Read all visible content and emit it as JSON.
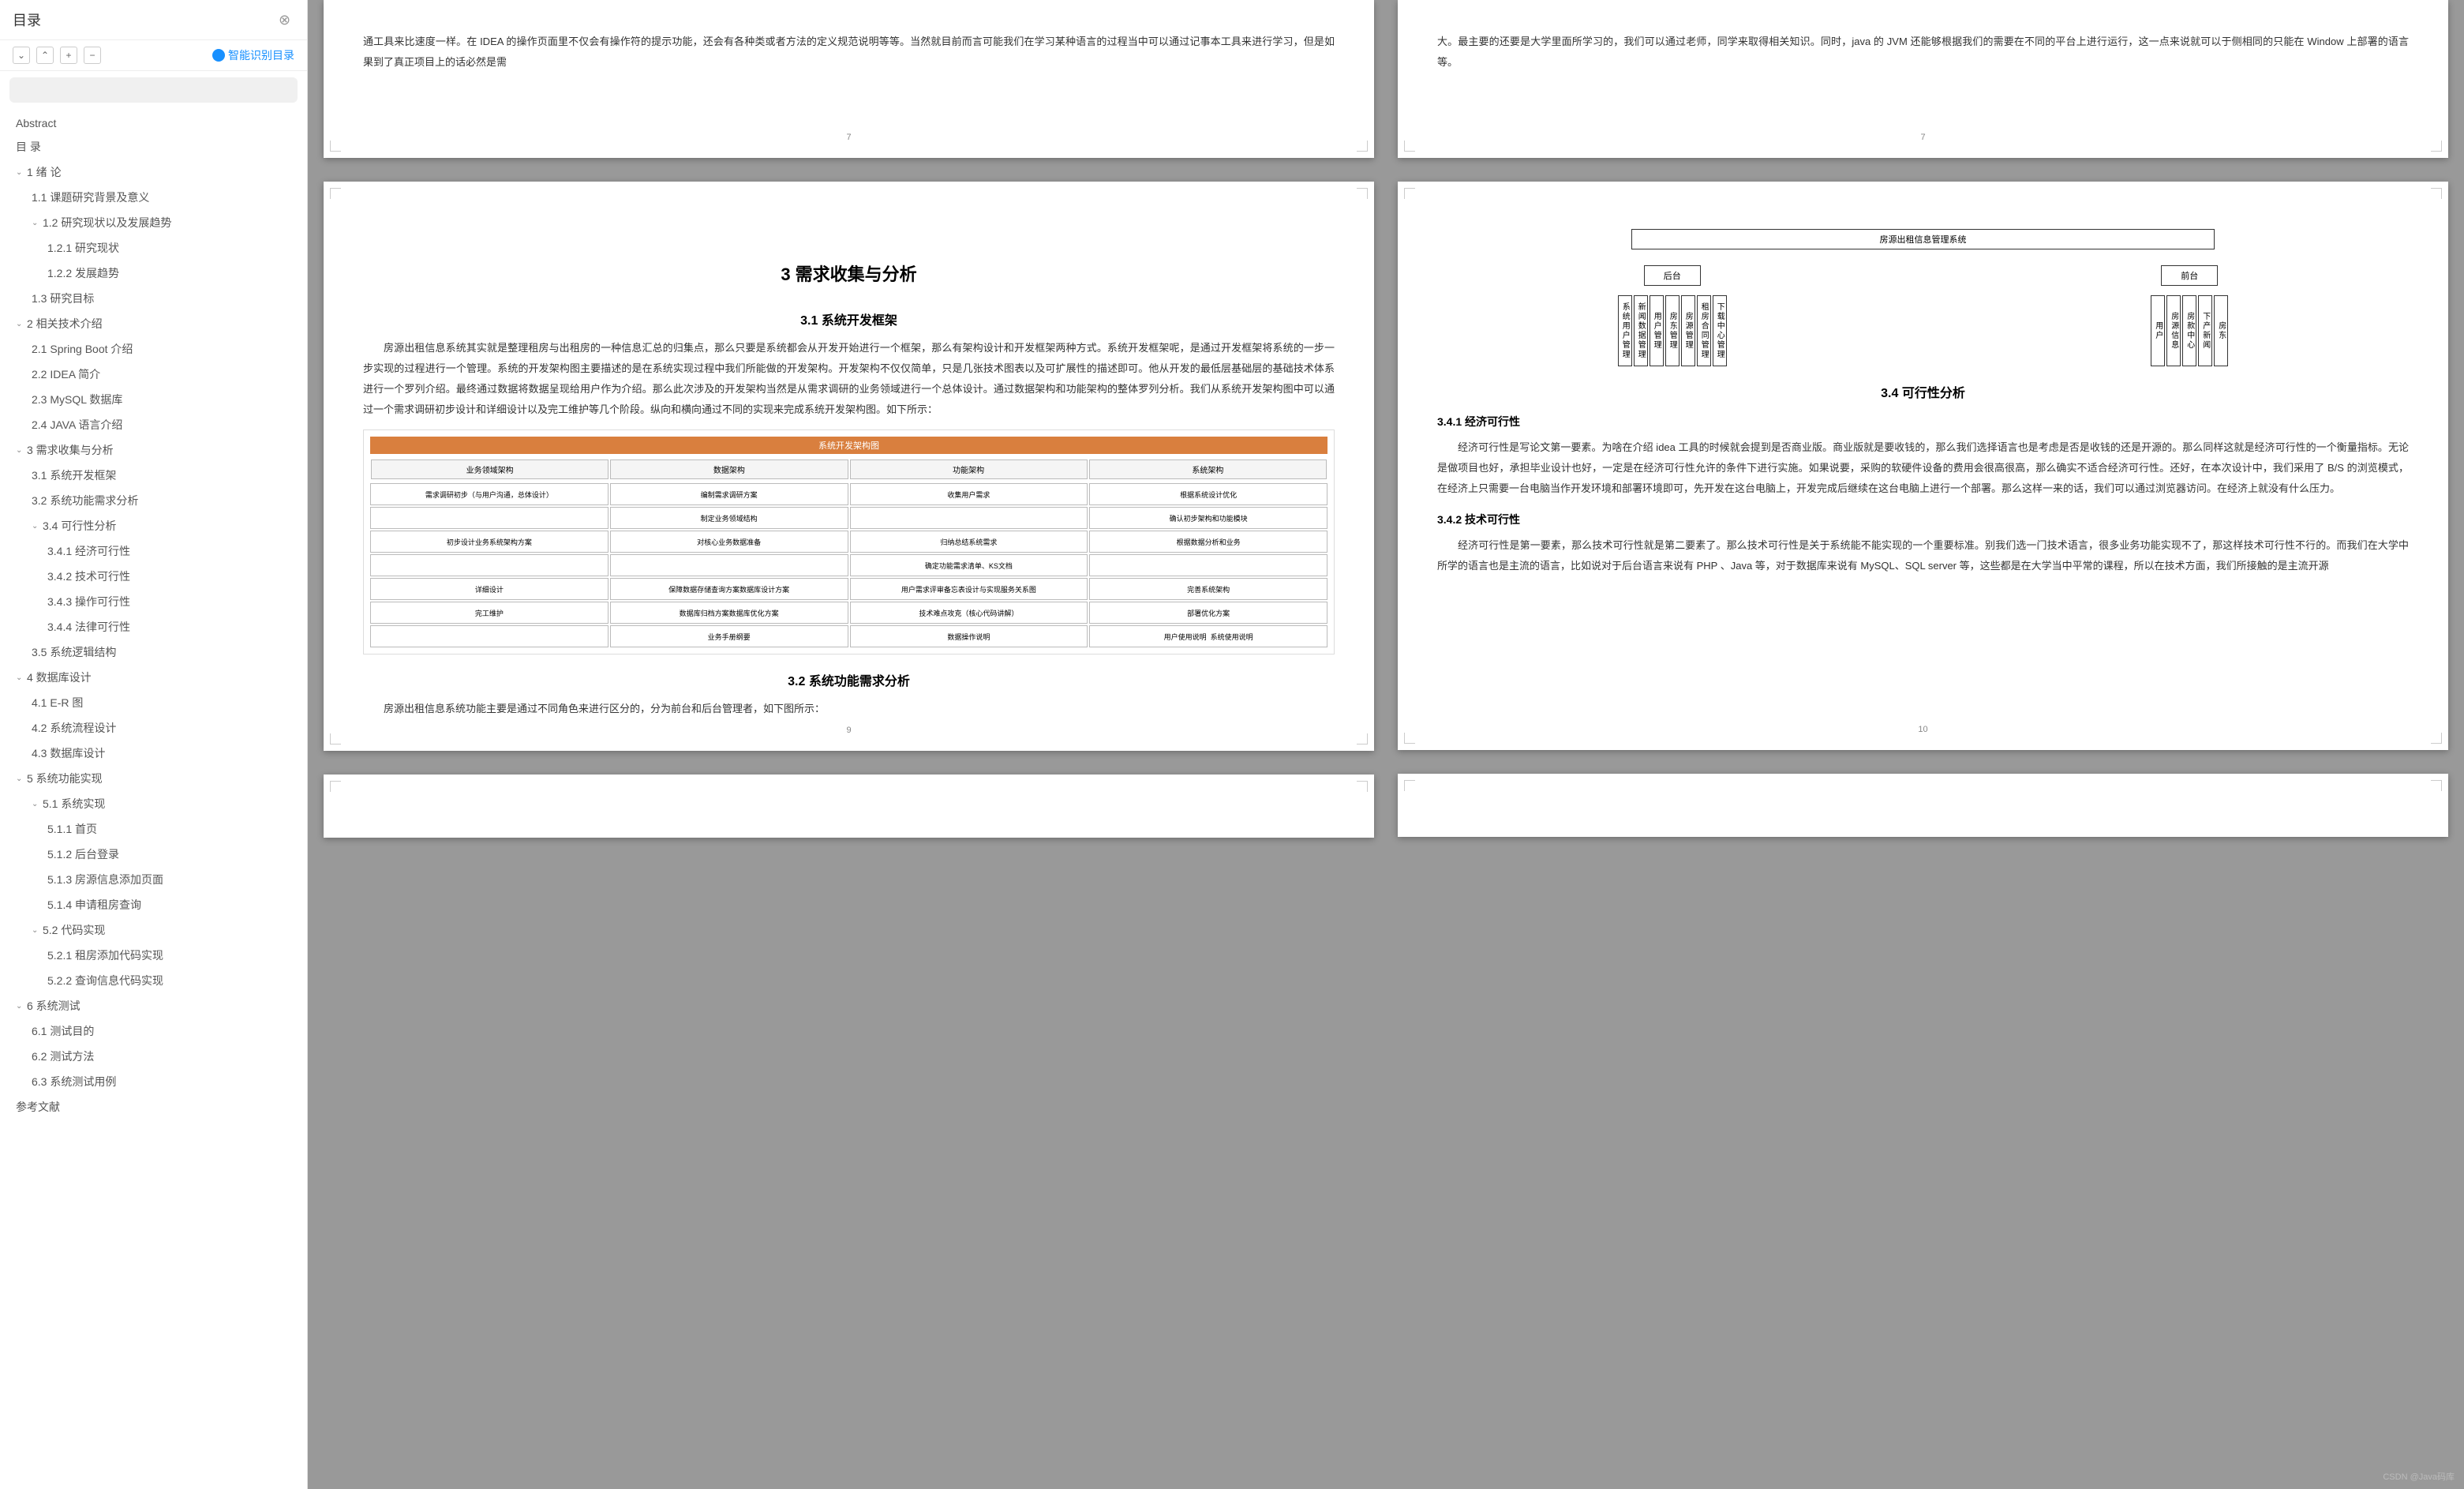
{
  "sidebar": {
    "title": "目录",
    "smart_recognize": "智能识别目录",
    "toolbar": {
      "collapse": "⌄",
      "expand": "⌃",
      "add": "+",
      "remove": "−"
    }
  },
  "toc": [
    {
      "level": 0,
      "label": "Abstract",
      "chev": false
    },
    {
      "level": 0,
      "label": "目 录",
      "chev": false
    },
    {
      "level": 1,
      "label": "1  绪  论",
      "chev": true
    },
    {
      "level": 2,
      "label": "1.1 课题研究背景及意义",
      "chev": false
    },
    {
      "level": 2,
      "label": "1.2 研究现状以及发展趋势",
      "chev": true
    },
    {
      "level": 3,
      "label": "1.2.1 研究现状",
      "chev": false
    },
    {
      "level": 3,
      "label": "1.2.2 发展趋势",
      "chev": false
    },
    {
      "level": 2,
      "label": "1.3 研究目标",
      "chev": false
    },
    {
      "level": 1,
      "label": "2  相关技术介绍",
      "chev": true
    },
    {
      "level": 2,
      "label": "2.1 Spring Boot 介绍",
      "chev": false
    },
    {
      "level": 2,
      "label": "2.2 IDEA 简介",
      "chev": false
    },
    {
      "level": 2,
      "label": "2.3 MySQL 数据库",
      "chev": false
    },
    {
      "level": 2,
      "label": "2.4 JAVA 语言介绍",
      "chev": false
    },
    {
      "level": 1,
      "label": "3  需求收集与分析",
      "chev": true
    },
    {
      "level": 2,
      "label": "3.1 系统开发框架",
      "chev": false
    },
    {
      "level": 2,
      "label": "3.2 系统功能需求分析",
      "chev": false
    },
    {
      "level": 2,
      "label": "3.4 可行性分析",
      "chev": true
    },
    {
      "level": 3,
      "label": "3.4.1 经济可行性",
      "chev": false
    },
    {
      "level": 3,
      "label": "3.4.2 技术可行性",
      "chev": false
    },
    {
      "level": 3,
      "label": "3.4.3 操作可行性",
      "chev": false
    },
    {
      "level": 3,
      "label": "3.4.4 法律可行性",
      "chev": false
    },
    {
      "level": 2,
      "label": "3.5 系统逻辑结构",
      "chev": false
    },
    {
      "level": 1,
      "label": "4  数据库设计",
      "chev": true
    },
    {
      "level": 2,
      "label": "4.1 E-R 图",
      "chev": false
    },
    {
      "level": 2,
      "label": "4.2 系统流程设计",
      "chev": false
    },
    {
      "level": 2,
      "label": "4.3 数据库设计",
      "chev": false
    },
    {
      "level": 1,
      "label": "5  系统功能实现",
      "chev": true
    },
    {
      "level": 2,
      "label": "5.1  系统实现",
      "chev": true
    },
    {
      "level": 3,
      "label": "5.1.1 首页",
      "chev": false
    },
    {
      "level": 3,
      "label": "5.1.2 后台登录",
      "chev": false
    },
    {
      "level": 3,
      "label": "5.1.3 房源信息添加页面",
      "chev": false
    },
    {
      "level": 3,
      "label": "5.1.4 申请租房查询",
      "chev": false
    },
    {
      "level": 2,
      "label": "5.2  代码实现",
      "chev": true
    },
    {
      "level": 3,
      "label": "5.2.1 租房添加代码实现",
      "chev": false
    },
    {
      "level": 3,
      "label": "5.2.2 查询信息代码实现",
      "chev": false
    },
    {
      "level": 1,
      "label": "6  系统测试",
      "chev": true
    },
    {
      "level": 2,
      "label": "6.1 测试目的",
      "chev": false
    },
    {
      "level": 2,
      "label": "6.2 测试方法",
      "chev": false
    },
    {
      "level": 2,
      "label": "6.3 系统测试用例",
      "chev": false
    },
    {
      "level": 0,
      "label": "参考文献",
      "chev": false
    }
  ],
  "pages": {
    "p7": {
      "num": "7",
      "text": "通工具来比速度一样。在 IDEA 的操作页面里不仅会有操作符的提示功能，还会有各种类或者方法的定义规范说明等等。当然就目前而言可能我们在学习某种语言的过程当中可以通过记事本工具来进行学习，但是如果到了真正项目上的话必然是需"
    },
    "p7r": {
      "num": "7",
      "text": "大。最主要的还要是大学里面所学习的，我们可以通过老师，同学来取得相关知识。同时，java 的 JVM 还能够根据我们的需要在不同的平台上进行运行，这一点来说就可以于侧相同的只能在 Window 上部署的语言等。"
    },
    "p9": {
      "num": "9",
      "h1": "3    需求收集与分析",
      "s31_title": "3.1  系统开发框架",
      "s31_text": "房源出租信息系统其实就是整理租房与出租房的一种信息汇总的归集点，那么只要是系统都会从开发开始进行一个框架，那么有架构设计和开发框架两种方式。系统开发框架呢，是通过开发框架将系统的一步一步实现的过程进行一个管理。系统的开发架构图主要描述的是在系统实现过程中我们所能做的开发架构。开发架构不仅仅简单，只是几张技术图表以及可扩展性的描述即可。他从开发的最低层基础层的基础技术体系进行一个罗列介绍。最终通过数据将数据呈现给用户作为介绍。那么此次涉及的开发架构当然是从需求调研的业务领域进行一个总体设计。通过数据架构和功能架构的整体罗列分析。我们从系统开发架构图中可以通过一个需求调研初步设计和详细设计以及完工维护等几个阶段。纵向和横向通过不同的实现来完成系统开发架构图。如下所示：",
      "diagram_title": "系统开发架构图",
      "diagram_headers": [
        "业务领域架构",
        "数据架构",
        "功能架构",
        "系统架构"
      ],
      "s32_title": "3.2  系统功能需求分析",
      "s32_text": "房源出租信息系统功能主要是通过不同角色来进行区分的，分为前台和后台管理者，如下图所示："
    },
    "p10": {
      "num": "10",
      "tree_root": "房源出租信息管理系统",
      "tree_nodes": [
        "后台",
        "前台"
      ],
      "tree_leaves_left": [
        "系统用户管理",
        "新闻数据管理",
        "用户管理",
        "房东管理",
        "房源管理",
        "租房合同管理",
        "下载中心管理"
      ],
      "tree_leaves_right": [
        "用户",
        "房源信息",
        "房款中心",
        "下产新闻",
        "房东"
      ],
      "s34_title": "3.4  可行性分析",
      "s341_title": "3.4.1 经济可行性",
      "s341_text": "经济可行性是写论文第一要素。为啥在介绍 idea 工具的时候就会提到是否商业版。商业版就是要收钱的，那么我们选择语言也是考虑是否是收钱的还是开源的。那么同样这就是经济可行性的一个衡量指标。无论是做项目也好，承担毕业设计也好，一定是在经济可行性允许的条件下进行实施。如果说要，采购的软硬件设备的费用会很高很高，那么确实不适合经济可行性。还好，在本次设计中，我们采用了 B/S 的浏览模式，在经济上只需要一台电脑当作开发环境和部署环境即可，先开发在这台电脑上，开发完成后继续在这台电脑上进行一个部署。那么这样一来的话，我们可以通过浏览器访问。在经济上就没有什么压力。",
      "s342_title": "3.4.2 技术可行性",
      "s342_text": "经济可行性是第一要素，那么技术可行性就是第二要素了。那么技术可行性是关于系统能不能实现的一个重要标准。别我们选一门技术语言，很多业务功能实现不了，那这样技术可行性不行的。而我们在大学中所学的语言也是主流的语言，比如说对于后台语言来说有 PHP 、Java 等，对于数据库来说有 MySQL、SQL server 等，这些都是在大学当中平常的课程，所以在技术方面，我们所接触的是主流开源"
    }
  },
  "watermark": "CSDN @Java码库"
}
